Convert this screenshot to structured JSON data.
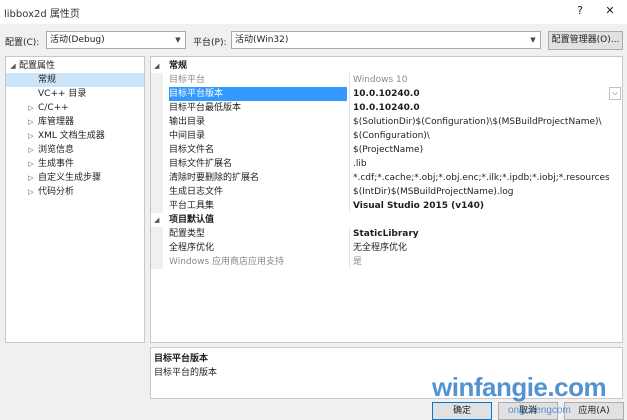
{
  "window": {
    "title": "libbox2d 属性页",
    "help_glyph": "?",
    "close_glyph": "✕"
  },
  "config_bar": {
    "config_label": "配置(C):",
    "config_value": "活动(Debug)",
    "platform_label": "平台(P):",
    "platform_value": "活动(Win32)",
    "manager_button": "配置管理器(O)..."
  },
  "tree": {
    "items": [
      {
        "label": "配置属性",
        "toggle": "◢"
      },
      {
        "label": "常规",
        "toggle": ""
      },
      {
        "label": "VC++ 目录",
        "toggle": ""
      },
      {
        "label": "C/C++",
        "toggle": "▷"
      },
      {
        "label": "库管理器",
        "toggle": "▷"
      },
      {
        "label": "XML 文档生成器",
        "toggle": "▷"
      },
      {
        "label": "浏览信息",
        "toggle": "▷"
      },
      {
        "label": "生成事件",
        "toggle": "▷"
      },
      {
        "label": "自定义生成步骤",
        "toggle": "▷"
      },
      {
        "label": "代码分析",
        "toggle": "▷"
      }
    ]
  },
  "grid": {
    "cat_general": "常规",
    "cat_defaults": "项目默认值",
    "cat_toggle": "◢",
    "rows_general": [
      {
        "name": "目标平台",
        "value": "Windows 10"
      },
      {
        "name": "目标平台版本",
        "value": "10.0.10240.0"
      },
      {
        "name": "目标平台最低版本",
        "value": "10.0.10240.0"
      },
      {
        "name": "输出目录",
        "value": "$(SolutionDir)$(Configuration)\\$(MSBuildProjectName)\\"
      },
      {
        "name": "中间目录",
        "value": "$(Configuration)\\"
      },
      {
        "name": "目标文件名",
        "value": "$(ProjectName)"
      },
      {
        "name": "目标文件扩展名",
        "value": ".lib"
      },
      {
        "name": "清除时要删除的扩展名",
        "value": "*.cdf;*.cache;*.obj;*.obj.enc;*.ilk;*.ipdb;*.iobj;*.resources;*.tlb;*.tli;*.t"
      },
      {
        "name": "生成日志文件",
        "value": "$(IntDir)$(MSBuildProjectName).log"
      },
      {
        "name": "平台工具集",
        "value": "Visual Studio 2015 (v140)"
      }
    ],
    "rows_defaults": [
      {
        "name": "配置类型",
        "value": "StaticLibrary"
      },
      {
        "name": "全程序优化",
        "value": "无全程序优化"
      },
      {
        "name": "Windows 应用商店应用支持",
        "value": "是"
      }
    ],
    "dropdown_glyph": "⌵"
  },
  "description": {
    "title": "目标平台版本",
    "text": "目标平台的版本"
  },
  "buttons": {
    "ok": "确定",
    "cancel": "取消",
    "apply": "应用(A)"
  },
  "watermark": {
    "big": "winfangie.com",
    "small": "ongchengcom"
  },
  "colors": {
    "selection": "#3399ff",
    "tree_selection": "#cce4f7",
    "accent": "#0078d7"
  }
}
